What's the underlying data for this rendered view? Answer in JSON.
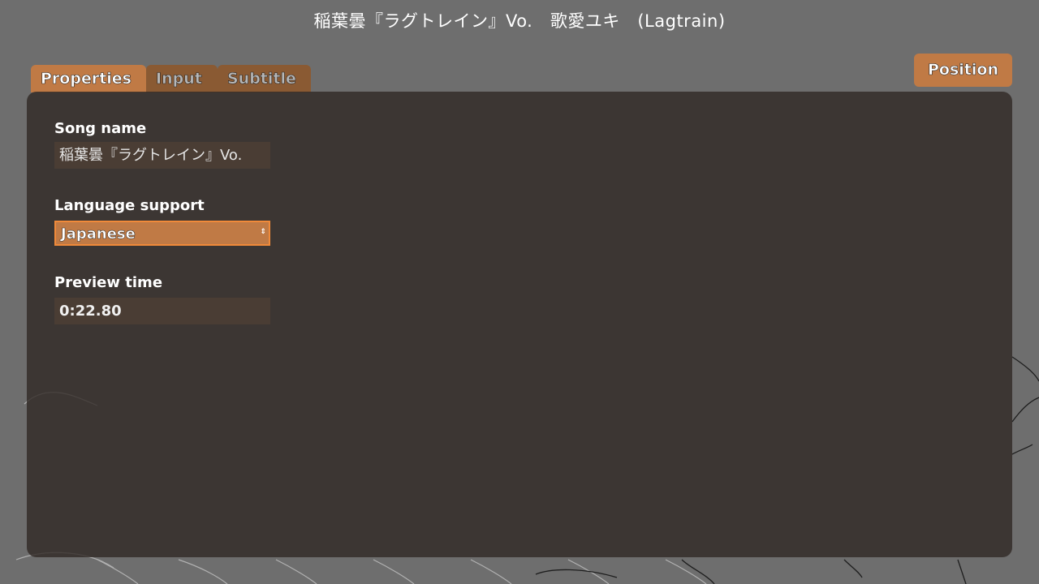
{
  "window": {
    "title": "稲葉曇『ラグトレイン』Vo.　歌愛ユキ　(Lagtrain)"
  },
  "tabs": [
    {
      "label": "Properties",
      "active": true
    },
    {
      "label": "Input",
      "active": false
    },
    {
      "label": "Subtitle",
      "active": false
    }
  ],
  "position_button": {
    "label": "Position"
  },
  "form": {
    "song_name": {
      "label": "Song name",
      "value": "稲葉曇『ラグトレイン』Vo."
    },
    "language_support": {
      "label": "Language support",
      "value": "Japanese"
    },
    "preview_time": {
      "label": "Preview time",
      "value": "0:22.80"
    }
  },
  "colors": {
    "accent": "#c07a45",
    "accent_inactive": "#8a5a33",
    "focus_border": "#f08a3a",
    "panel": "#30282480",
    "background": "#6e6e6e"
  },
  "icons": {
    "select_arrow": "updown-arrows-icon"
  }
}
